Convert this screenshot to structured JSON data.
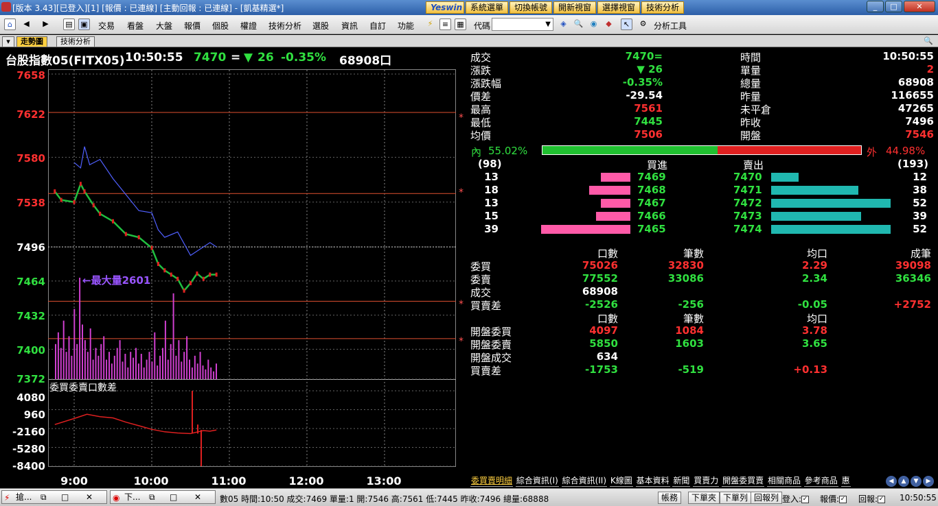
{
  "window": {
    "title": "[版本 3.43][已登入][1] [報價 : 已連線] [主動回報 : 已連線] - [凱基精選*]",
    "top_buttons": [
      "Yeswin",
      "系統選單",
      "切換帳號",
      "開新視窗",
      "選擇視窗",
      "技術分析"
    ]
  },
  "menubar": {
    "items": [
      "交易",
      "看盤",
      "大盤",
      "報價",
      "個股",
      "權證",
      "技術分析",
      "選股",
      "資訊",
      "自訂",
      "功能"
    ],
    "code_label": "代碼",
    "code_value": "",
    "analysis_tools": "分析工具"
  },
  "tabs": [
    "走勢圖",
    "技術分析"
  ],
  "headline": {
    "name": "台股指數05(FITX05)",
    "time": "10:50:55",
    "price": "7470",
    "eq": "=",
    "arrow": "▼",
    "change": "26",
    "pct": "-0.35%",
    "volume": "68908口"
  },
  "chart_data": [
    {
      "type": "line",
      "title": "台股指數05(FITX05)",
      "y_ticks": [
        "7658",
        "7622",
        "7580",
        "7538",
        "7496",
        "7464",
        "7432",
        "7400",
        "7372"
      ],
      "ylim": [
        7372,
        7658
      ],
      "x_ticks": [
        "9:00",
        "10:00",
        "11:00",
        "12:00",
        "13:00"
      ],
      "reference_lines": [
        7622,
        7546,
        7445,
        7410
      ],
      "annotation": "最大量2601",
      "series": [
        {
          "name": "成交價",
          "color": "#20c040",
          "x": [
            "08:45",
            "08:50",
            "09:00",
            "09:05",
            "09:08",
            "09:15",
            "09:20",
            "09:30",
            "09:40",
            "09:50",
            "10:00",
            "10:05",
            "10:10",
            "10:15",
            "10:20",
            "10:25",
            "10:30",
            "10:35",
            "10:40",
            "10:45",
            "10:50"
          ],
          "values": [
            7548,
            7540,
            7538,
            7555,
            7548,
            7535,
            7527,
            7520,
            7508,
            7505,
            7495,
            7480,
            7474,
            7470,
            7466,
            7455,
            7462,
            7471,
            7466,
            7470,
            7470
          ]
        },
        {
          "name": "",
          "color": "#5060ff",
          "x": [
            "09:00",
            "09:05",
            "09:08",
            "09:12",
            "09:20",
            "09:30",
            "09:40",
            "09:50",
            "10:00",
            "10:05",
            "10:10",
            "10:20",
            "10:30",
            "10:35",
            "10:45",
            "10:50"
          ],
          "values": [
            7575,
            7570,
            7590,
            7573,
            7578,
            7560,
            7545,
            7530,
            7528,
            7512,
            7505,
            7510,
            7488,
            7492,
            7500,
            7496
          ]
        }
      ],
      "volume_max": 2601
    },
    {
      "type": "line",
      "title": "委買委賣口數差",
      "y_ticks": [
        "4080",
        "960",
        "-2160",
        "-5280",
        "-8400"
      ],
      "ylim": [
        -8400,
        4080
      ],
      "x": [
        "08:45",
        "09:00",
        "09:10",
        "09:20",
        "09:30",
        "09:40",
        "09:50",
        "10:00",
        "10:10",
        "10:20",
        "10:30",
        "10:40",
        "10:45",
        "10:50"
      ],
      "values": [
        -1500,
        -500,
        200,
        -200,
        -400,
        -1100,
        -1700,
        -2300,
        -2700,
        -2900,
        -3000,
        -2500,
        -2600,
        -2400
      ]
    }
  ],
  "stats": {
    "left": [
      {
        "label": "成交",
        "value": "7470=",
        "cls": "g"
      },
      {
        "label": "漲跌",
        "value": "▼ 26",
        "cls": "g"
      },
      {
        "label": "漲跌幅",
        "value": "-0.35%",
        "cls": "g"
      },
      {
        "label": "價差",
        "value": "-29.54",
        "cls": "w"
      },
      {
        "label": "最高",
        "value": "7561",
        "cls": "r"
      },
      {
        "label": "最低",
        "value": "7445",
        "cls": "g"
      },
      {
        "label": "均價",
        "value": "7506",
        "cls": "r"
      }
    ],
    "right": [
      {
        "label": "時間",
        "value": "10:50:55",
        "cls": "w"
      },
      {
        "label": "單量",
        "value": "2",
        "cls": "r"
      },
      {
        "label": "總量",
        "value": "68908",
        "cls": "w"
      },
      {
        "label": "昨量",
        "value": "116655",
        "cls": "w"
      },
      {
        "label": "未平倉",
        "value": "47265",
        "cls": "w"
      },
      {
        "label": "昨收",
        "value": "7496",
        "cls": "w"
      },
      {
        "label": "開盤",
        "value": "7546",
        "cls": "r"
      }
    ]
  },
  "inout": {
    "in_label": "內",
    "in_pct": "55.02%",
    "out_label": "外",
    "out_pct": "44.98%",
    "in_ratio": 0.5502
  },
  "orderbook": {
    "bid_total": "(98)",
    "ask_total": "(193)",
    "bid_header": "買進",
    "ask_header": "賣出",
    "rows": [
      {
        "bid_qty": 13,
        "bid": "7469",
        "ask": "7470",
        "ask_qty": 12
      },
      {
        "bid_qty": 18,
        "bid": "7468",
        "ask": "7471",
        "ask_qty": 38
      },
      {
        "bid_qty": 13,
        "bid": "7467",
        "ask": "7472",
        "ask_qty": 52
      },
      {
        "bid_qty": 15,
        "bid": "7466",
        "ask": "7473",
        "ask_qty": 39
      },
      {
        "bid_qty": 39,
        "bid": "7465",
        "ask": "7474",
        "ask_qty": 52
      }
    ]
  },
  "detail": {
    "headers": [
      "口數",
      "筆數",
      "均口",
      "成筆"
    ],
    "rows": [
      {
        "label": "委買",
        "v": [
          "75026",
          "32830",
          "2.29",
          "39098"
        ],
        "cls": [
          "r",
          "r",
          "r",
          "r"
        ]
      },
      {
        "label": "委賣",
        "v": [
          "77552",
          "33086",
          "2.34",
          "36346"
        ],
        "cls": [
          "g",
          "g",
          "g",
          "g"
        ]
      },
      {
        "label": "成交",
        "v": [
          "68908",
          "",
          "",
          ""
        ],
        "cls": [
          "w",
          "",
          "",
          ""
        ]
      },
      {
        "label": "買賣差",
        "v": [
          "-2526",
          "-256",
          "-0.05",
          "+2752"
        ],
        "cls": [
          "g",
          "g",
          "g",
          "r"
        ]
      }
    ],
    "headers2": [
      "口數",
      "筆數",
      "均口"
    ],
    "rows2": [
      {
        "label": "開盤委買",
        "v": [
          "4097",
          "1084",
          "3.78"
        ],
        "cls": [
          "r",
          "r",
          "r"
        ]
      },
      {
        "label": "開盤委賣",
        "v": [
          "5850",
          "1603",
          "3.65"
        ],
        "cls": [
          "g",
          "g",
          "g"
        ]
      },
      {
        "label": "開盤成交",
        "v": [
          "634",
          "",
          ""
        ],
        "cls": [
          "w",
          "",
          ""
        ]
      },
      {
        "label": "買賣差",
        "v": [
          "-1753",
          "-519",
          "+0.13"
        ],
        "cls": [
          "g",
          "g",
          "r"
        ]
      }
    ]
  },
  "bottom_tabs": [
    "委買賣明細",
    "綜合資訊(I)",
    "綜合資訊(II)",
    "K線圖",
    "基本資料",
    "新聞",
    "買賣力",
    "開盤委買賣",
    "相關商品",
    "參考商品",
    "惠"
  ],
  "taskbar": {
    "task1": "搶...",
    "task2": "下...",
    "ticker": "數05 時間:10:50 成交:7469 單量:1 開:7546 高:7561 低:7445 昨收:7496 總量:68888",
    "buttons": [
      "帳務",
      "下單夾",
      "下單列",
      "回報列"
    ],
    "login_label": "登入:",
    "quote_label": "報價:",
    "report_label": "回報:",
    "clock": "10:50:55"
  }
}
